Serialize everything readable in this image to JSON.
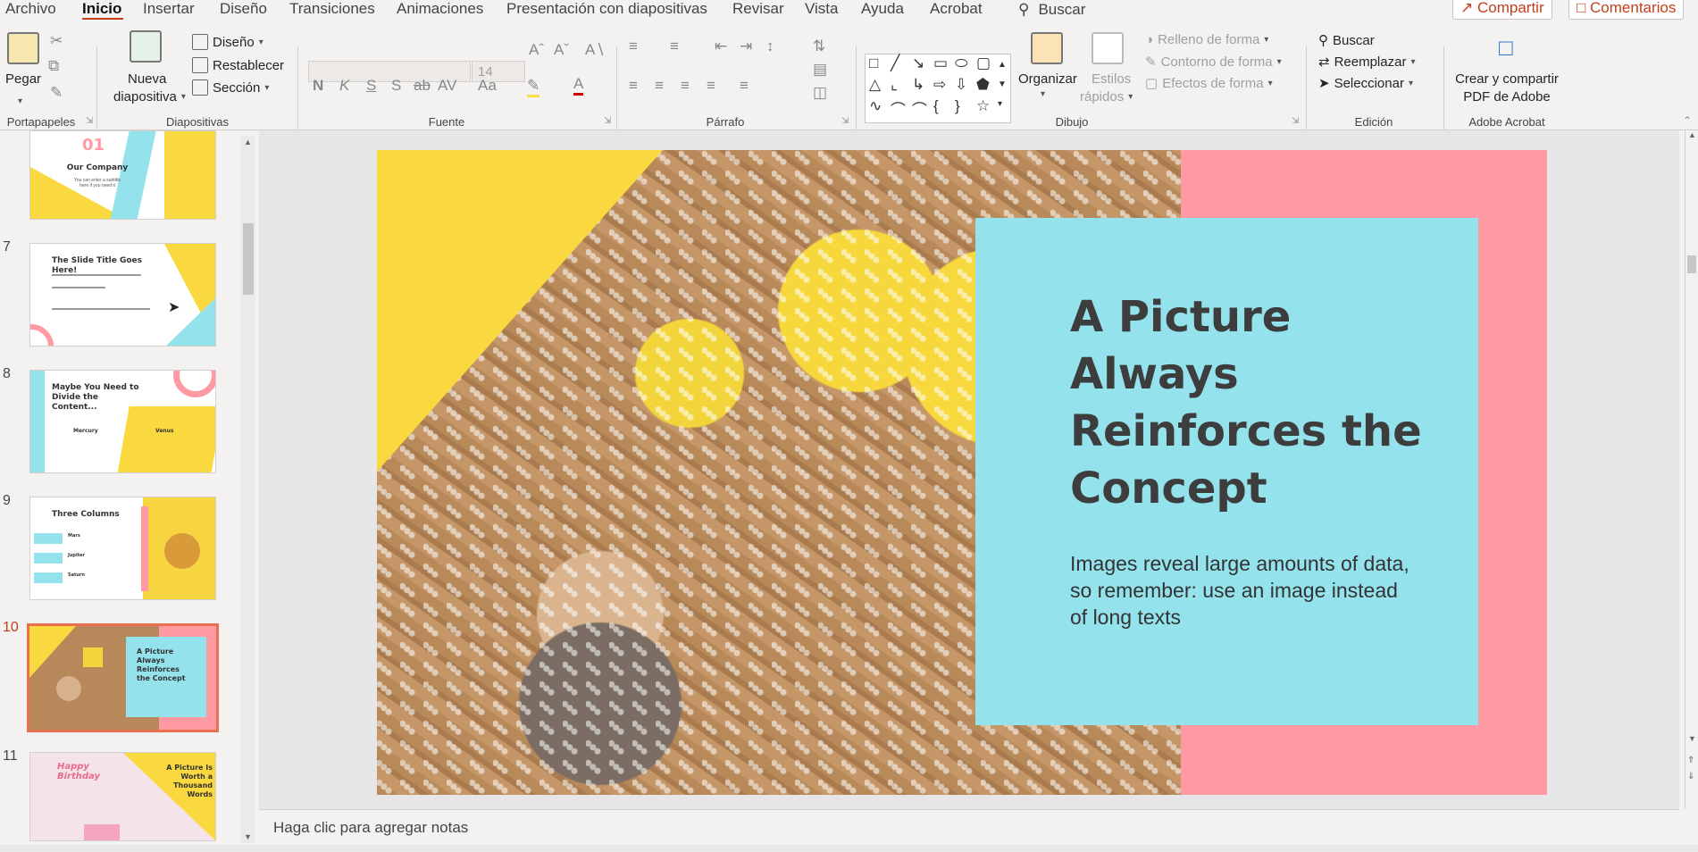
{
  "menu": {
    "items": [
      "Archivo",
      "Inicio",
      "Insertar",
      "Diseño",
      "Transiciones",
      "Animaciones",
      "Presentación con diapositivas",
      "Revisar",
      "Vista",
      "Ayuda",
      "Acrobat"
    ],
    "search": "Buscar",
    "share": "Compartir",
    "comments": "Comentarios"
  },
  "ribbon": {
    "portapapeles": {
      "paste": "Pegar",
      "label": "Portapapeles"
    },
    "diapositivas": {
      "new_slide_1": "Nueva",
      "new_slide_2": "diapositiva",
      "design": "Diseño",
      "reset": "Restablecer",
      "section": "Sección",
      "label": "Diapositivas"
    },
    "fuente": {
      "size": "14",
      "label": "Fuente",
      "bold": "N",
      "italic": "K",
      "underline": "S",
      "shadow": "S",
      "strike": "ab",
      "spacing": "AV",
      "case": "Aa",
      "color": "A"
    },
    "parrafo": {
      "label": "Párrafo"
    },
    "dibujo": {
      "arrange": "Organizar",
      "styles_1": "Estilos",
      "styles_2": "rápidos",
      "fill": "Relleno de forma",
      "outline": "Contorno de forma",
      "effects": "Efectos de forma",
      "label": "Dibujo"
    },
    "edicion": {
      "find": "Buscar",
      "replace": "Reemplazar",
      "select": "Seleccionar",
      "label": "Edición"
    },
    "acrobat": {
      "create_1": "Crear y compartir",
      "create_2": "PDF de Adobe",
      "label": "Adobe Acrobat"
    }
  },
  "thumbnails": [
    {
      "num": "",
      "title": "Our Company",
      "big": "01",
      "sub": "You can enter a subtitle here if you need it"
    },
    {
      "num": "7",
      "title": "The Slide Title Goes Here!"
    },
    {
      "num": "8",
      "title": "Maybe You Need to Divide the Content...",
      "col1": "Mercury",
      "col2": "Venus"
    },
    {
      "num": "9",
      "title": "Three Columns",
      "c1": "Mars",
      "c2": "Jupiter",
      "c3": "Saturn"
    },
    {
      "num": "10",
      "title": "A Picture Always Reinforces the Concept",
      "selected": true
    },
    {
      "num": "11",
      "title": "A Picture Is Worth a Thousand Words",
      "script": "Happy Birthday"
    }
  ],
  "slide": {
    "title": "A Picture Always Reinforces the Concept",
    "body": "Images reveal large amounts of data, so remember: use an image instead of long texts"
  },
  "notes_placeholder": "Haga clic para agregar notas",
  "colors": {
    "accent": "#c43e1c",
    "slide_yellow": "#f9d93f",
    "slide_pink": "#ff9aa2",
    "slide_blue": "#93e2ec"
  }
}
